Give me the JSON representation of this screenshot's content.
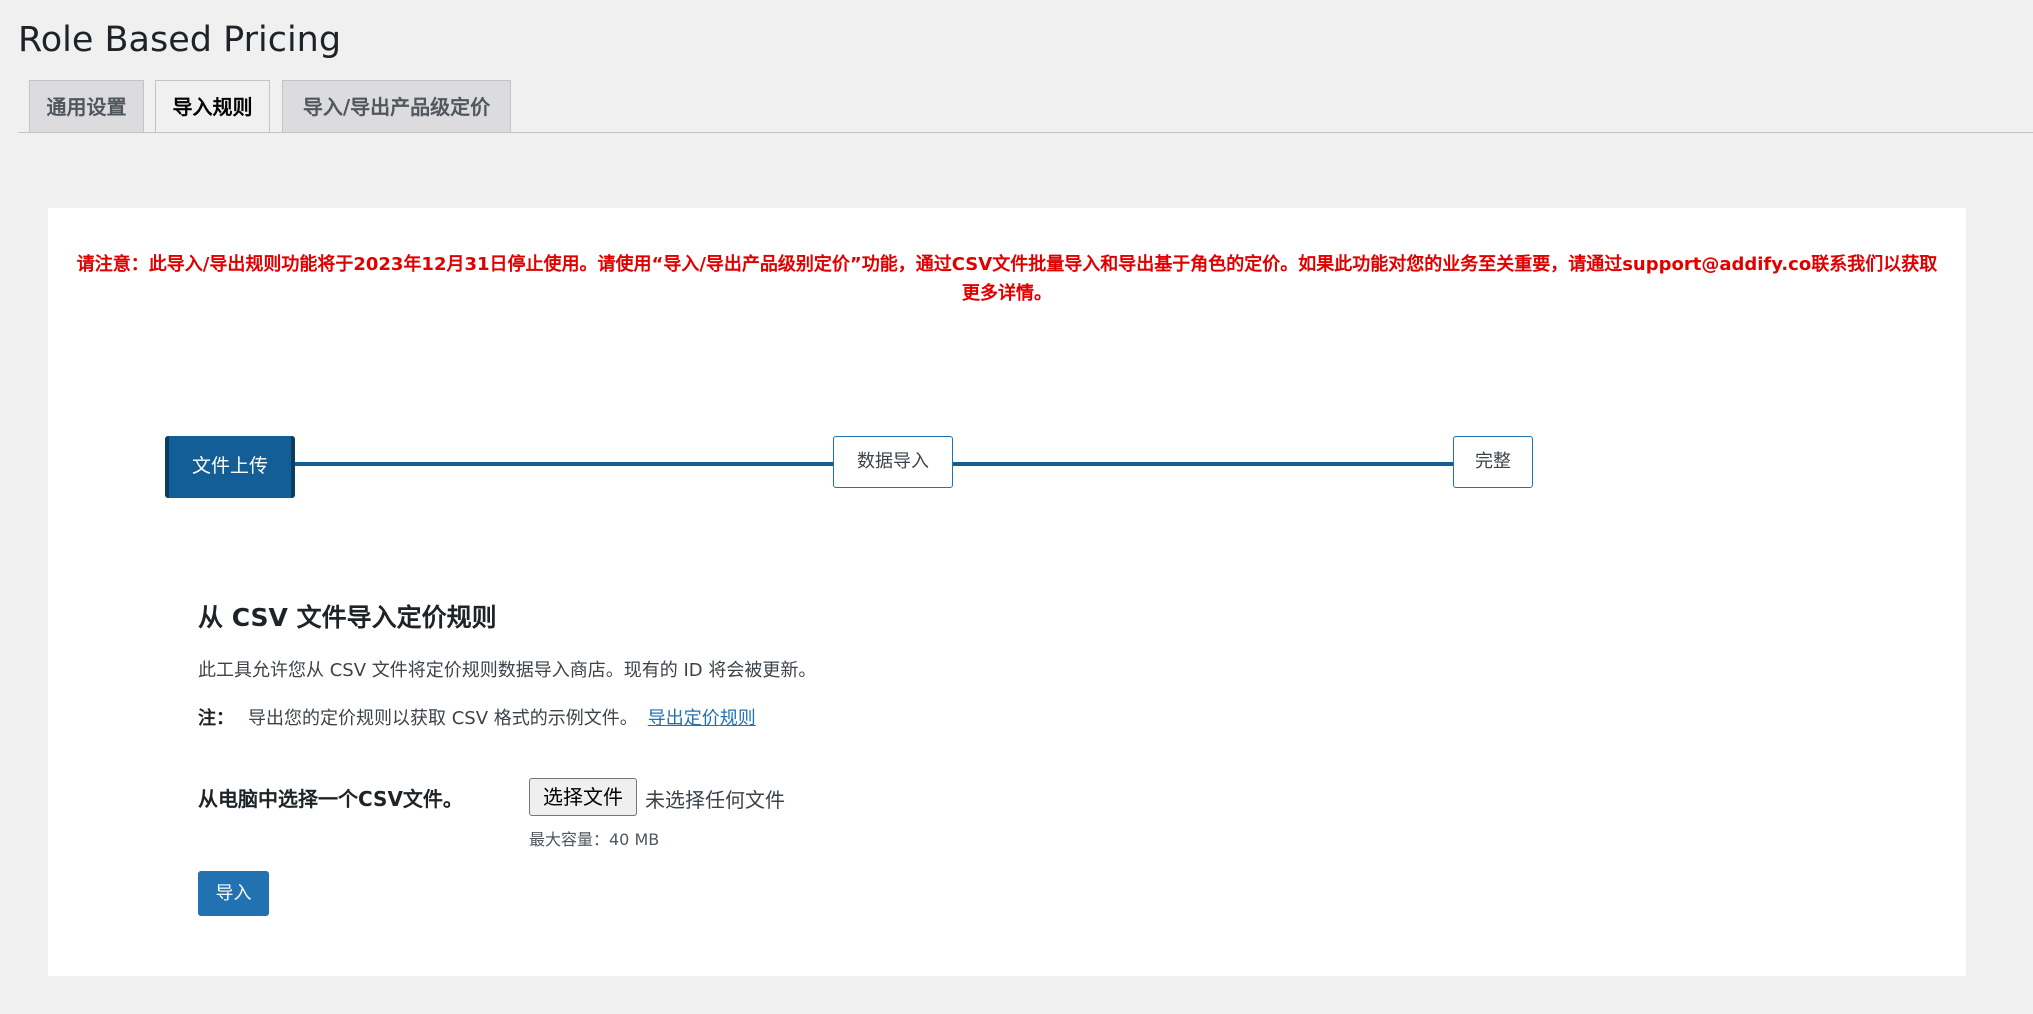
{
  "page": {
    "title": "Role Based Pricing"
  },
  "tabs": [
    {
      "label": "通用设置",
      "active": false
    },
    {
      "label": "导入规则",
      "active": true
    },
    {
      "label": "导入/导出产品级定价",
      "active": false
    }
  ],
  "notice": {
    "text": "请注意：此导入/导出规则功能将于2023年12月31日停止使用。请使用“导入/导出产品级别定价”功能，通过CSV文件批量导入和导出基于角色的定价。如果此功能对您的业务至关重要，请通过support@addify.co联系我们以获取更多详情。",
    "color": "#e00000"
  },
  "steps": [
    {
      "label": "文件上传",
      "active": true
    },
    {
      "label": "数据导入",
      "active": false
    },
    {
      "label": "完整",
      "active": false
    }
  ],
  "section": {
    "title": "从 CSV 文件导入定价规则",
    "description": "此工具允许您从 CSV 文件将定价规则数据导入商店。现有的 ID 将会被更新。",
    "note_label": "注：",
    "note_text": "导出您的定价规则以获取 CSV 格式的示例文件。",
    "note_link": "导出定价规则"
  },
  "file_upload": {
    "label": "从电脑中选择一个CSV文件。",
    "button_label": "选择文件",
    "status": "未选择任何文件",
    "max_size": "最大容量：40 MB"
  },
  "import_button": {
    "label": "导入"
  },
  "colors": {
    "primary": "#2271b1",
    "primary_dark": "#135e96",
    "background": "#f0f0f1"
  }
}
